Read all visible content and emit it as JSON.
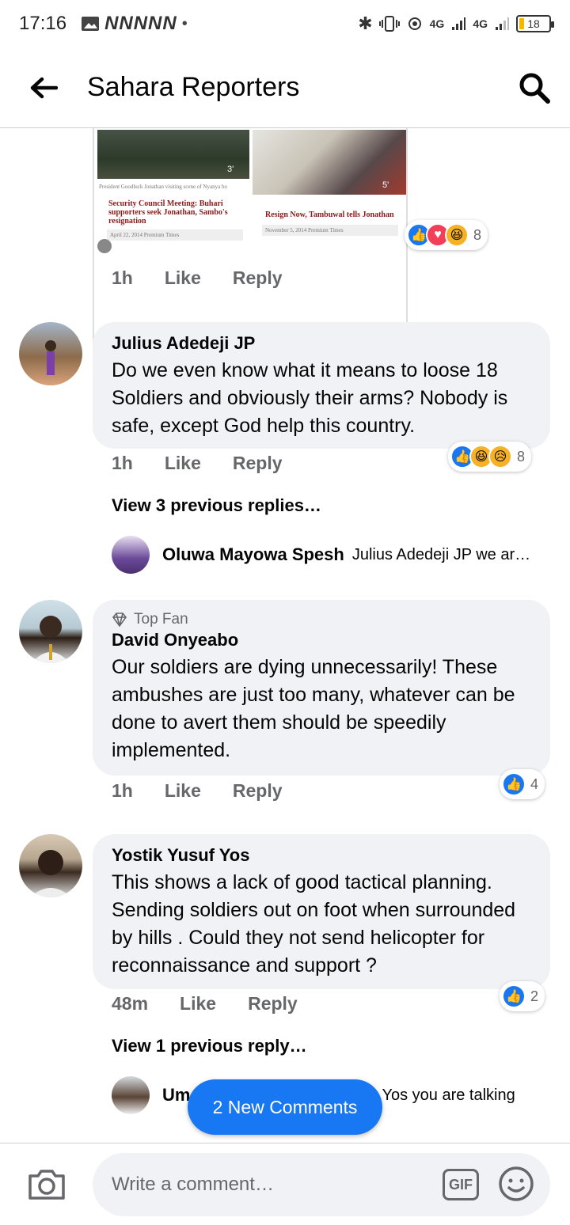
{
  "status_bar": {
    "time": "17:16",
    "network_glyphs": "NNNNN",
    "network_label_1": "4G",
    "network_label_2": "4G",
    "battery": "18"
  },
  "header": {
    "title": "Sahara Reporters"
  },
  "link_preview": {
    "photo1_time": "3'",
    "photo2_time": "5'",
    "caption": "President Goodluck Jonathan visiting scene of Nyanya bo",
    "headline_left": "Security Council Meeting: Buhari supporters seek Jonathan, Sambo's resignation",
    "meta_left": "April 22, 2014    Premium Times",
    "headline_right": "Resign Now, Tambuwal tells Jonathan",
    "meta_right": "November 5, 2014    Premium Times",
    "reaction_count": "8",
    "time": "1h",
    "like": "Like",
    "reply": "Reply"
  },
  "comments": [
    {
      "author": "Julius Adedeji JP",
      "text": "Do we even know what it means to loose 18 Soldiers and obviously their arms? Nobody is safe, except God help this country.",
      "time": "1h",
      "like": "Like",
      "reply": "Reply",
      "reaction_count": "8",
      "view_replies": "View 3 previous replies…",
      "reply_preview_author": "Oluwa Mayowa Spesh",
      "reply_preview_text": "Julius Adedeji JP we ar…"
    },
    {
      "badge": "Top Fan",
      "author": "David Onyeabo",
      "text": "Our soldiers are dying unnecessarily! These ambushes are just too many, whatever can be done to avert them should be speedily implemented.",
      "time": "1h",
      "like": "Like",
      "reply": "Reply",
      "reaction_count": "4"
    },
    {
      "author": "Yostik Yusuf Yos",
      "text": "This shows a lack of good tactical planning. Sending soldiers out on foot when surrounded by hills . Could they not send helicopter for reconnaissance and support ?",
      "time": "48m",
      "like": "Like",
      "reply": "Reply",
      "reaction_count": "2",
      "view_replies": "View 1 previous reply…",
      "reply_preview_author": "Um",
      "reply_preview_text": "Yos you are talking"
    }
  ],
  "new_comments_button": "2 New Comments",
  "composer": {
    "placeholder": "Write a comment…",
    "gif_label": "GIF"
  },
  "colors": {
    "accent": "#1877f2",
    "bubble": "#f0f2f5",
    "secondary_text": "#65676b"
  }
}
